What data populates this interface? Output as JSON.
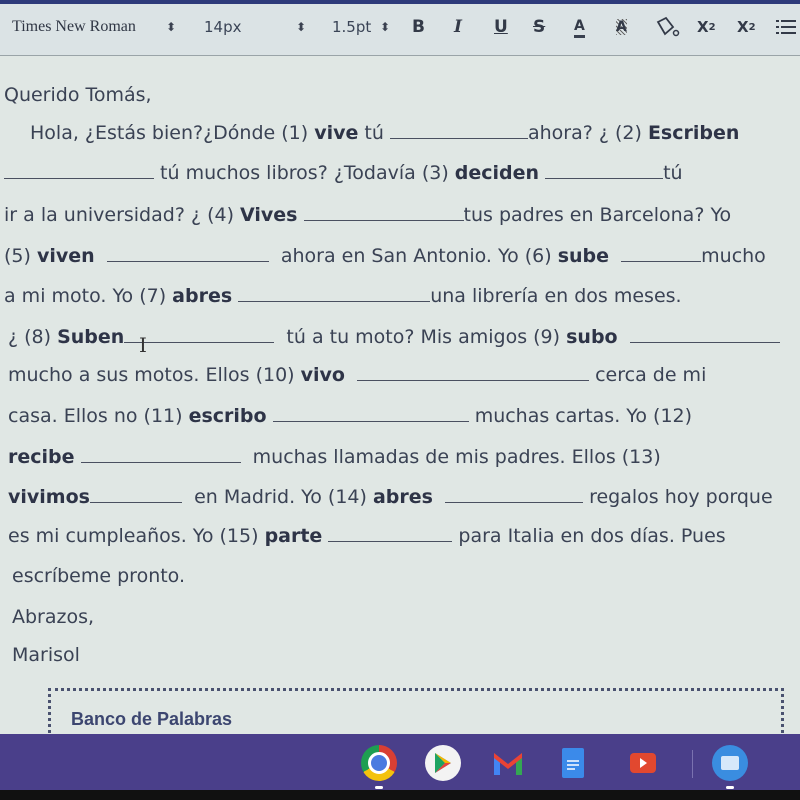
{
  "toolbar": {
    "font_family": "Times New Roman",
    "font_size": "14px",
    "line_spacing": "1.5pt",
    "stepper_glyph": "⬍",
    "buttons": {
      "bold": "B",
      "italic": "I",
      "underline": "U",
      "strikethrough": "S",
      "text_color": "A",
      "highlight": "A",
      "subscript_base": "X",
      "subscript_mark": "2",
      "superscript_base": "X",
      "superscript_mark": "2"
    },
    "icons": [
      "paint-bucket-icon",
      "numbered-list-icon"
    ]
  },
  "letter": {
    "greeting": "Querido Tomás,",
    "lines": [
      {
        "pre": "Hola, ¿Estás bien?¿Dónde (1) ",
        "verb": "vive",
        "post": " tú",
        "after": "ahora? ¿ (2) ",
        "verb2": "Escriben"
      },
      {
        "after": " tú muchos libros? ¿Todavía (3) ",
        "verb": "deciden",
        "end": "tú"
      },
      {
        "pre": "ir a la universidad? ¿ (4) ",
        "verb": "Vives",
        "after": "tus padres en  Barcelona? Yo"
      },
      {
        "pre": "(5) ",
        "verb": "viven",
        "after": "ahora en San Antonio. Yo (6) ",
        "verb2": "sube",
        "end": "mucho"
      },
      {
        "pre": "a mi moto. Yo (7) ",
        "verb": "abres",
        "after": "una librería en dos meses."
      },
      {
        "pre": "¿ (8) ",
        "verb": "Suben",
        "after": "tú a tu moto? Mis amigos (9) ",
        "verb2": "subo"
      },
      {
        "pre": "mucho a sus motos. Ellos (10) ",
        "verb": "vivo",
        "after": "cerca de mi"
      },
      {
        "pre": "casa. Ellos no  (11) ",
        "verb": "escribo",
        "after": "muchas cartas. Yo  (12)"
      },
      {
        "verb": "recibe",
        "after": "muchas llamadas de mis padres. Ellos  (13)"
      },
      {
        "verb": "vivimos",
        "after": "en Madrid. Yo  (14) ",
        "verb2": "abres",
        "end": "regalos hoy porque"
      },
      {
        "pre": "es mi cumpleaños. Yo (15) ",
        "verb": "parte",
        "after": "para Italia en dos días. Pues"
      },
      {
        "pre": "escríbeme pronto."
      }
    ],
    "closing": "Abrazos,",
    "signature": "Marisol"
  },
  "word_bank": {
    "title": "Banco de Palabras"
  },
  "shelf": {
    "apps": [
      "Chrome",
      "Play Store",
      "Gmail",
      "Docs",
      "YouTube",
      "Files"
    ]
  }
}
